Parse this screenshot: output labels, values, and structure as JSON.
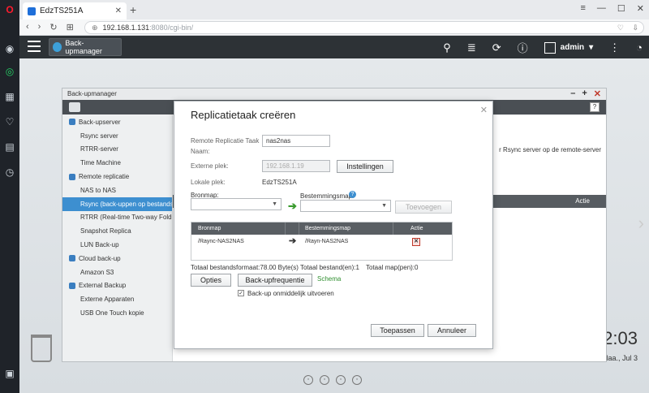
{
  "browser": {
    "tab_title": "EdzTS251A",
    "new_tab": "+",
    "url_host": "192.168.1.131",
    "url_path": ":8080/cgi-bin/"
  },
  "qts": {
    "app_tab_label": "Back-upmanager",
    "user_name": "admin"
  },
  "desktop": {
    "clock": "2:03",
    "date": "Maa., Jul 3"
  },
  "backup_manager": {
    "title": "Back-upmanager",
    "main_desc": "r Rsync server op de remote-server",
    "table_actie": "Actie",
    "sidebar": [
      {
        "label": "Back-upserver",
        "type": "cat"
      },
      {
        "label": "Rsync server",
        "type": "item"
      },
      {
        "label": "RTRR-server",
        "type": "item"
      },
      {
        "label": "Time Machine",
        "type": "item"
      },
      {
        "label": "Remote replicatie",
        "type": "cat"
      },
      {
        "label": "NAS to NAS",
        "type": "item"
      },
      {
        "label": "Rsync (back-uppen op bestandsn...",
        "type": "item",
        "active": true
      },
      {
        "label": "RTRR (Real-time Two-way Folder ...",
        "type": "item"
      },
      {
        "label": "Snapshot Replica",
        "type": "item"
      },
      {
        "label": "LUN Back-up",
        "type": "item"
      },
      {
        "label": "Cloud back-up",
        "type": "cat"
      },
      {
        "label": "Amazon S3",
        "type": "item"
      },
      {
        "label": "External Backup",
        "type": "cat"
      },
      {
        "label": "Externe Apparaten",
        "type": "item"
      },
      {
        "label": "USB One Touch kopie",
        "type": "item"
      }
    ]
  },
  "dialog": {
    "title": "Replicatietaak creëren",
    "task_name_label": "Remote Replicatie Taak",
    "task_name_label2": "Naam:",
    "task_name_value": "nas2nas",
    "external_label": "Externe plek:",
    "external_value": "192.168.1.19",
    "settings_button": "Instellingen",
    "local_label": "Lokale plek:",
    "local_value": "EdzTS251A",
    "source_label": "Bronmap:",
    "dest_label": "Bestemmingsmap:",
    "add_button": "Toevoegen",
    "col_source": "Bronmap",
    "col_dest": "Bestemmingsmap",
    "col_action": "Actie",
    "row_source": "/Raync-NAS2NAS",
    "row_dest": "/Rayn-NAS2NAS",
    "total_size": "Totaal bestandsformaat:78.00 Byte(s)",
    "total_files": "Totaal bestand(en):1",
    "total_folders": "Totaal map(pen):0",
    "options_button": "Opties",
    "frequency_button": "Back-upfrequentie",
    "schema_link": "Schema",
    "run_now_label": "Back-up onmiddelijk uitvoeren",
    "apply_button": "Toepassen",
    "cancel_button": "Annuleer"
  }
}
